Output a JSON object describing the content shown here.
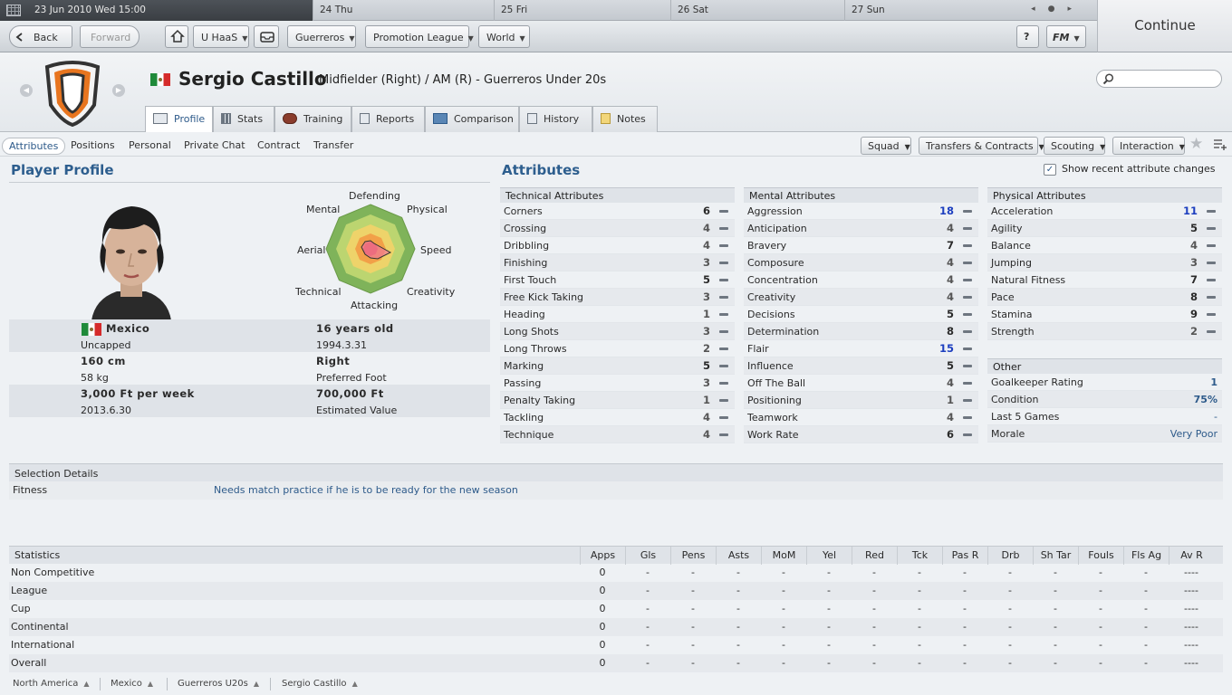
{
  "datebar": {
    "current": "23 Jun 2010 Wed 15:00",
    "days": [
      "24 Thu",
      "25 Fri",
      "26 Sat",
      "27 Sun"
    ]
  },
  "toolbar": {
    "back": "Back",
    "forward": "Forward",
    "manager": "U HaaS",
    "club": "Guerreros",
    "league": "Promotion League",
    "world": "World",
    "help": "?",
    "fm": "FM",
    "continue": "Continue"
  },
  "player": {
    "name": "Sergio Castillo",
    "role": "Midfielder (Right) / AM (R) - Guerreros Under 20s"
  },
  "tabs": [
    "Profile",
    "Stats",
    "Training",
    "Reports",
    "Comparison",
    "History",
    "Notes"
  ],
  "subnav": [
    "Attributes",
    "Positions",
    "Personal",
    "Private Chat",
    "Contract",
    "Transfer"
  ],
  "subnav_buttons": [
    "Squad",
    "Transfers & Contracts",
    "Scouting",
    "Interaction"
  ],
  "profile": {
    "title": "Player Profile",
    "radar_labels": [
      "Defending",
      "Physical",
      "Speed",
      "Creativity",
      "Attacking",
      "Technical",
      "Aerial",
      "Mental"
    ],
    "nationality": "Mexico",
    "caps": "Uncapped",
    "age": "16 years old",
    "dob": "1994.3.31",
    "height": "160 cm",
    "weight": "58 kg",
    "foot": "Right",
    "foot_label": "Preferred Foot",
    "wage": "3,000 Ft per week",
    "contract_end": "2013.6.30",
    "value": "700,000 Ft",
    "value_label": "Estimated Value"
  },
  "attributes": {
    "title": "Attributes",
    "show_changes": "Show recent attribute changes",
    "technical": {
      "header": "Technical Attributes",
      "rows": [
        {
          "name": "Corners",
          "value": "6"
        },
        {
          "name": "Crossing",
          "value": "4"
        },
        {
          "name": "Dribbling",
          "value": "4"
        },
        {
          "name": "Finishing",
          "value": "3"
        },
        {
          "name": "First Touch",
          "value": "5"
        },
        {
          "name": "Free Kick Taking",
          "value": "3"
        },
        {
          "name": "Heading",
          "value": "1"
        },
        {
          "name": "Long Shots",
          "value": "3"
        },
        {
          "name": "Long Throws",
          "value": "2"
        },
        {
          "name": "Marking",
          "value": "5"
        },
        {
          "name": "Passing",
          "value": "3"
        },
        {
          "name": "Penalty Taking",
          "value": "1"
        },
        {
          "name": "Tackling",
          "value": "4"
        },
        {
          "name": "Technique",
          "value": "4"
        }
      ]
    },
    "mental": {
      "header": "Mental Attributes",
      "rows": [
        {
          "name": "Aggression",
          "value": "18"
        },
        {
          "name": "Anticipation",
          "value": "4"
        },
        {
          "name": "Bravery",
          "value": "7"
        },
        {
          "name": "Composure",
          "value": "4"
        },
        {
          "name": "Concentration",
          "value": "4"
        },
        {
          "name": "Creativity",
          "value": "4"
        },
        {
          "name": "Decisions",
          "value": "5"
        },
        {
          "name": "Determination",
          "value": "8"
        },
        {
          "name": "Flair",
          "value": "15"
        },
        {
          "name": "Influence",
          "value": "5"
        },
        {
          "name": "Off The Ball",
          "value": "4"
        },
        {
          "name": "Positioning",
          "value": "1"
        },
        {
          "name": "Teamwork",
          "value": "4"
        },
        {
          "name": "Work Rate",
          "value": "6"
        }
      ]
    },
    "physical": {
      "header": "Physical Attributes",
      "rows": [
        {
          "name": "Acceleration",
          "value": "11"
        },
        {
          "name": "Agility",
          "value": "5"
        },
        {
          "name": "Balance",
          "value": "4"
        },
        {
          "name": "Jumping",
          "value": "3"
        },
        {
          "name": "Natural Fitness",
          "value": "7"
        },
        {
          "name": "Pace",
          "value": "8"
        },
        {
          "name": "Stamina",
          "value": "9"
        },
        {
          "name": "Strength",
          "value": "2"
        }
      ]
    },
    "other": {
      "header": "Other",
      "rows": [
        {
          "name": "Goalkeeper Rating",
          "value": "1"
        },
        {
          "name": "Condition",
          "value": "75%"
        },
        {
          "name": "Last 5 Games",
          "value": "-"
        },
        {
          "name": "Morale",
          "value": "Very Poor"
        }
      ]
    }
  },
  "selection": {
    "header": "Selection Details",
    "label": "Fitness",
    "value": "Needs match practice if he is to be ready for the new season"
  },
  "statistics": {
    "columns": [
      "Statistics",
      "Apps",
      "Gls",
      "Pens",
      "Asts",
      "MoM",
      "Yel",
      "Red",
      "Tck",
      "Pas R",
      "Drb",
      "Sh Tar",
      "Fouls",
      "Fls Ag",
      "Av R"
    ],
    "rows": [
      [
        "Non Competitive",
        "0",
        "-",
        "-",
        "-",
        "-",
        "-",
        "-",
        "-",
        "-",
        "-",
        "-",
        "-",
        "-",
        "----"
      ],
      [
        "League",
        "0",
        "-",
        "-",
        "-",
        "-",
        "-",
        "-",
        "-",
        "-",
        "-",
        "-",
        "-",
        "-",
        "----"
      ],
      [
        "Cup",
        "0",
        "-",
        "-",
        "-",
        "-",
        "-",
        "-",
        "-",
        "-",
        "-",
        "-",
        "-",
        "-",
        "----"
      ],
      [
        "Continental",
        "0",
        "-",
        "-",
        "-",
        "-",
        "-",
        "-",
        "-",
        "-",
        "-",
        "-",
        "-",
        "-",
        "----"
      ],
      [
        "International",
        "0",
        "-",
        "-",
        "-",
        "-",
        "-",
        "-",
        "-",
        "-",
        "-",
        "-",
        "-",
        "-",
        "----"
      ],
      [
        "Overall",
        "0",
        "-",
        "-",
        "-",
        "-",
        "-",
        "-",
        "-",
        "-",
        "-",
        "-",
        "-",
        "-",
        "----"
      ]
    ]
  },
  "breadcrumbs": [
    "North America",
    "Mexico",
    "Guerreros U20s",
    "Sergio Castillo"
  ],
  "colors": {
    "accent": "#2d5e8e",
    "highlight_value": "#1d3fbf",
    "flag_green": "#1f8a3a",
    "flag_red": "#d52b2b"
  }
}
